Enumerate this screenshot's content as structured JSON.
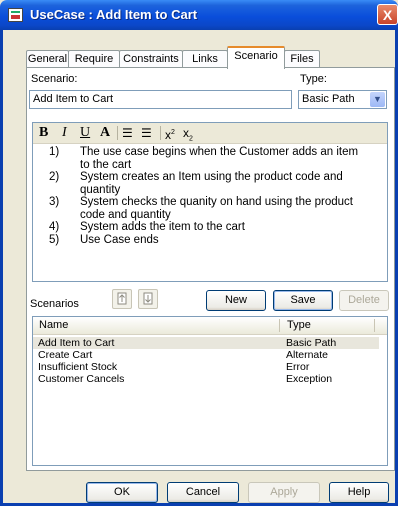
{
  "window": {
    "title": "UseCase : Add Item to Cart",
    "close": "X"
  },
  "tabs": [
    "General",
    "Require",
    "Constraints",
    "Links",
    "Scenario",
    "Files"
  ],
  "scenario": {
    "label": "Scenario:",
    "value": "Add Item to Cart"
  },
  "type": {
    "label": "Type:",
    "value": "Basic Path"
  },
  "format_toolbar": {
    "bold": "B",
    "italic": "I",
    "underline": "U",
    "font_color": "A",
    "superscript": "x",
    "sup_mark": "2",
    "subscript": "x",
    "sub_mark": "2"
  },
  "steps": [
    {
      "num": "1)",
      "line1": "The use case begins when the Customer adds an item",
      "line2": "to the cart"
    },
    {
      "num": "2)",
      "line1": "System creates an Item using the product code and",
      "line2": "quantity"
    },
    {
      "num": "3)",
      "line1": "System checks the quanity on hand using the product",
      "line2": "code and quantity"
    },
    {
      "num": "4)",
      "line1": "System adds the item to the cart",
      "line2": ""
    },
    {
      "num": "5)",
      "line1": "Use Case ends",
      "line2": ""
    }
  ],
  "scenarios_label": "Scenarios",
  "buttons": {
    "new": "New",
    "save": "Save",
    "delete": "Delete",
    "ok": "OK",
    "cancel": "Cancel",
    "apply": "Apply",
    "help": "Help"
  },
  "list": {
    "columns": [
      "Name",
      "Type"
    ],
    "rows": [
      {
        "name": "Add Item to Cart",
        "type": "Basic Path"
      },
      {
        "name": "Create Cart",
        "type": "Alternate"
      },
      {
        "name": "Insufficient Stock",
        "type": "Error"
      },
      {
        "name": "Customer Cancels",
        "type": "Exception"
      }
    ]
  },
  "colors": {
    "titlebar": "#0A4EDB",
    "dialog_bg": "#ECE9D8",
    "active_tab_accent": "#E68B2C",
    "selected_row": "#E8E6DC"
  }
}
